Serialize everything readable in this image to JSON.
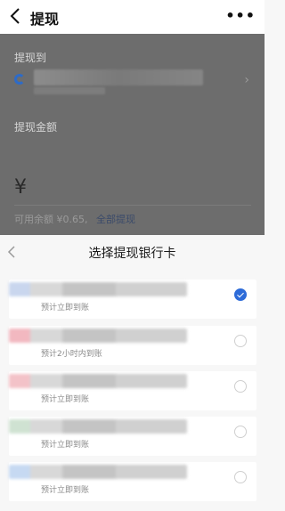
{
  "nav": {
    "title": "提现",
    "more": "•••"
  },
  "form": {
    "to_label": "提现到",
    "amount_label": "提现金额",
    "currency": "¥",
    "balance_text": "可用余额 ¥0.65,",
    "withdraw_all": "全部提现"
  },
  "sheet": {
    "title": "选择提现银行卡",
    "cards": [
      {
        "arrival": "预计立即到账",
        "selected": true,
        "accent": "#c9d6ee"
      },
      {
        "arrival": "预计2小时内到账",
        "selected": false,
        "accent": "#f2b8c0"
      },
      {
        "arrival": "预计立即到账",
        "selected": false,
        "accent": "#f3c2c8"
      },
      {
        "arrival": "预计立即到账",
        "selected": false,
        "accent": "#cfe2d2"
      },
      {
        "arrival": "预计立即到账",
        "selected": false,
        "accent": "#c6d9f2"
      }
    ]
  },
  "colors": {
    "accent_blue": "#2d6bd8"
  }
}
